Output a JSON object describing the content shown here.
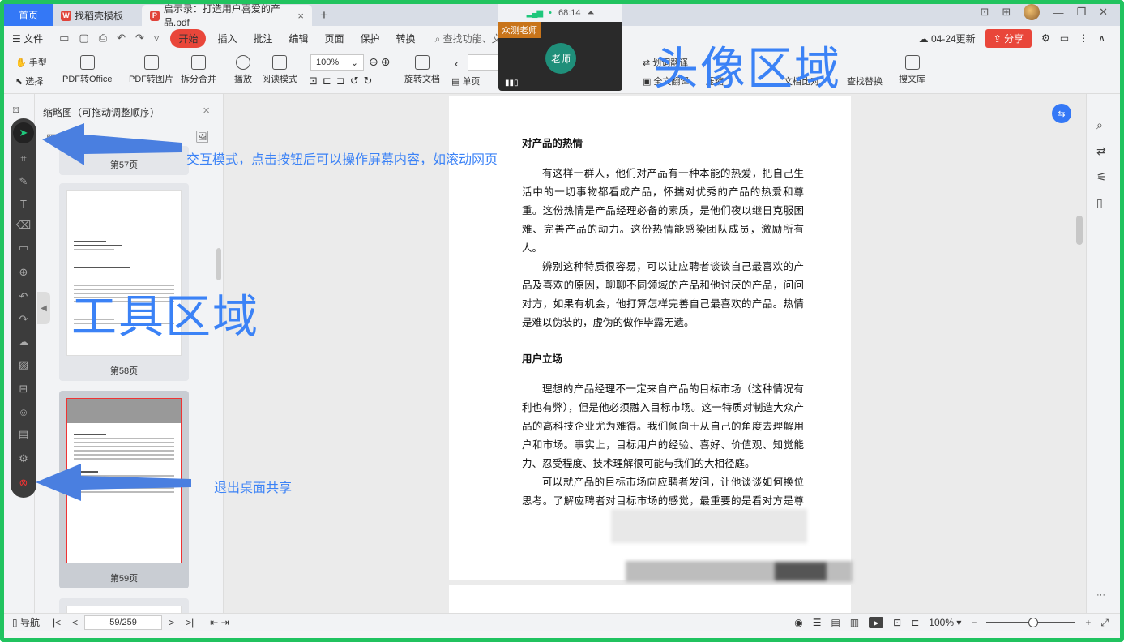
{
  "tabs": {
    "home": "首页",
    "template": "找稻壳模板",
    "document": "启示录：打造用户喜爱的产品.pdf",
    "close": "×",
    "add": "+"
  },
  "menu": {
    "file": "文件",
    "start": "开始",
    "items": [
      "插入",
      "批注",
      "编辑",
      "页面",
      "保护",
      "转换"
    ],
    "search": "查找功能、文档",
    "update": "04-24更新",
    "share": "分享"
  },
  "ribbon": {
    "hand": "手型",
    "select": "选择",
    "pdf_to_office": "PDF转Office",
    "pdf_to_image": "PDF转图片",
    "split_merge": "拆分合并",
    "play": "播放",
    "read_mode": "阅读模式",
    "zoom": "100%",
    "rotate": "旋转文档",
    "single_page": "单页",
    "translate": "划词翻译",
    "full_translate": "全文翻译",
    "compress": "压缩",
    "compare": "文档比对",
    "replace": "查找替换",
    "search_lib": "搜文库"
  },
  "thumbnails": {
    "title": "缩略图（可拖动调整顺序）",
    "pages": [
      "第57页",
      "第58页",
      "第59页"
    ]
  },
  "document": {
    "heading1": "对产品的热情",
    "para1": "有这样一群人，他们对产品有一种本能的热爱，把自己生活中的一切事物都看成产品，怀揣对优秀的产品的热爱和尊重。这份热情是产品经理必备的素质，是他们夜以继日克服困难、完善产品的动力。这份热情能感染团队成员，激励所有人。",
    "para2": "辨别这种特质很容易，可以让应聘者谈谈自己最喜欢的产品及喜欢的原因，聊聊不同领域的产品和他讨厌的产品，问问对方，如果有机会，他打算怎样完善自己最喜欢的产品。热情是难以伪装的，虚伪的做作毕露无遗。",
    "heading2": "用户立场",
    "para3": "理想的产品经理不一定来自产品的目标市场（这种情况有利也有弊），但是他必须融入目标市场。这一特质对制造大众产品的高科技企业尤为难得。我们倾向于从自己的角度去理解用户和市场。事实上，目标用户的经验、喜好、价值观、知觉能力、忍受程度、技术理解很可能与我们的大相径庭。",
    "para4": "可以就产品的目标市场向应聘者发问，让他谈谈如何换位思考。了解应聘者对目标市场的感觉，最重要的是看对方是尊重目标市场希望融入其中"
  },
  "status": {
    "nav": "导航",
    "page": "59/259",
    "zoom": "100%"
  },
  "video": {
    "time": "68:14",
    "teacher": "众测老师",
    "avatar_label": "老师"
  },
  "overlays": {
    "avatar_area": "头像区域",
    "tool_area": "工具区域",
    "interactive_mode": "交互模式，点击按钮后可以操作屏幕内容，如滚动网页",
    "exit_share": "退出桌面共享"
  },
  "colors": {
    "accent": "#3478f6",
    "frame": "#21c35f",
    "overlay": "#3b82f6",
    "danger": "#e9463a"
  }
}
